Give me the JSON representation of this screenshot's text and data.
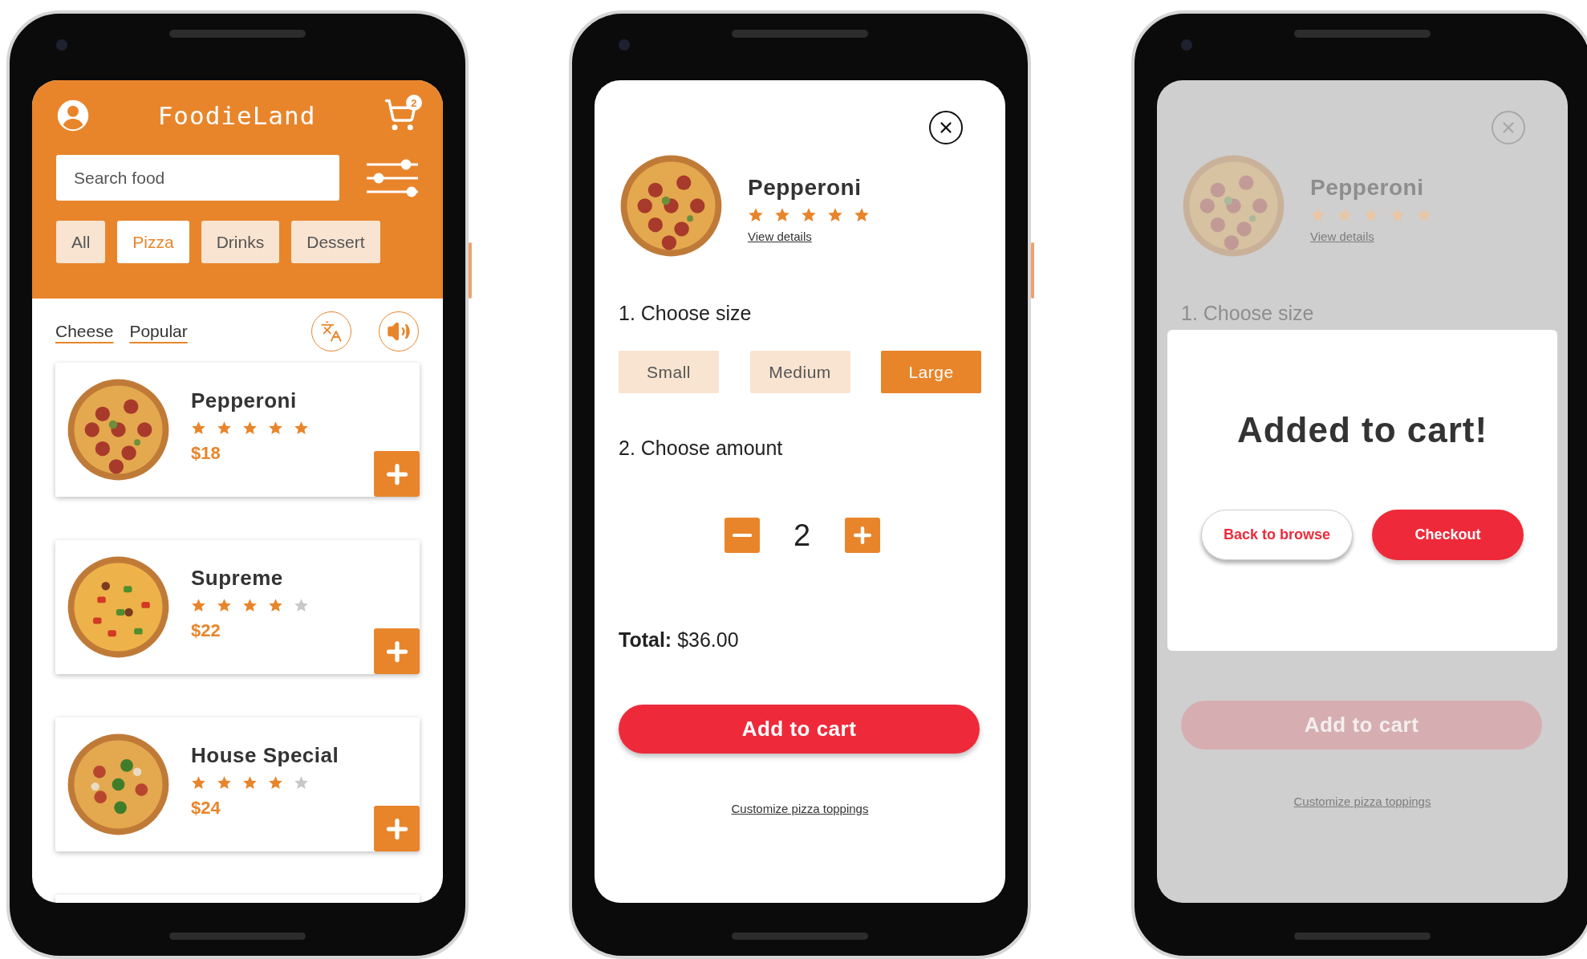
{
  "browse": {
    "title": "FoodieLand",
    "cart_count": "2",
    "search": {
      "placeholder": "Search food"
    },
    "categories": [
      {
        "label": "All",
        "selected": false
      },
      {
        "label": "Pizza",
        "selected": true
      },
      {
        "label": "Drinks",
        "selected": false
      },
      {
        "label": "Dessert",
        "selected": false
      }
    ],
    "tags": [
      "Cheese",
      "Popular"
    ],
    "items": [
      {
        "name": "Pepperoni",
        "stars": 5,
        "price": "$18"
      },
      {
        "name": "Supreme",
        "stars": 4,
        "price": "$22"
      },
      {
        "name": "House Special",
        "stars": 4,
        "price": "$24"
      }
    ]
  },
  "detail": {
    "product": {
      "name": "Pepperoni",
      "stars": 5,
      "link": "View details"
    },
    "size_heading": "1. Choose size",
    "sizes": [
      {
        "label": "Small",
        "selected": false
      },
      {
        "label": "Medium",
        "selected": false
      },
      {
        "label": "Large",
        "selected": true
      }
    ],
    "amount_heading": "2. Choose amount",
    "quantity": "2",
    "total": "**Total:** $36.00",
    "add_button": "Add to cart",
    "customize_link": "Customize pizza toppings"
  },
  "confirm": {
    "product": {
      "name": "Pepperoni",
      "stars": 5,
      "link": "View details"
    },
    "size_heading": "1. Choose size",
    "add_button": "Add to cart",
    "customize_link": "Customize pizza toppings",
    "dialog": {
      "message": "Added to cart!",
      "buttons": [
        {
          "label": "Back to browse",
          "kind": "secondary"
        },
        {
          "label": "Checkout",
          "kind": "primary"
        }
      ]
    }
  }
}
